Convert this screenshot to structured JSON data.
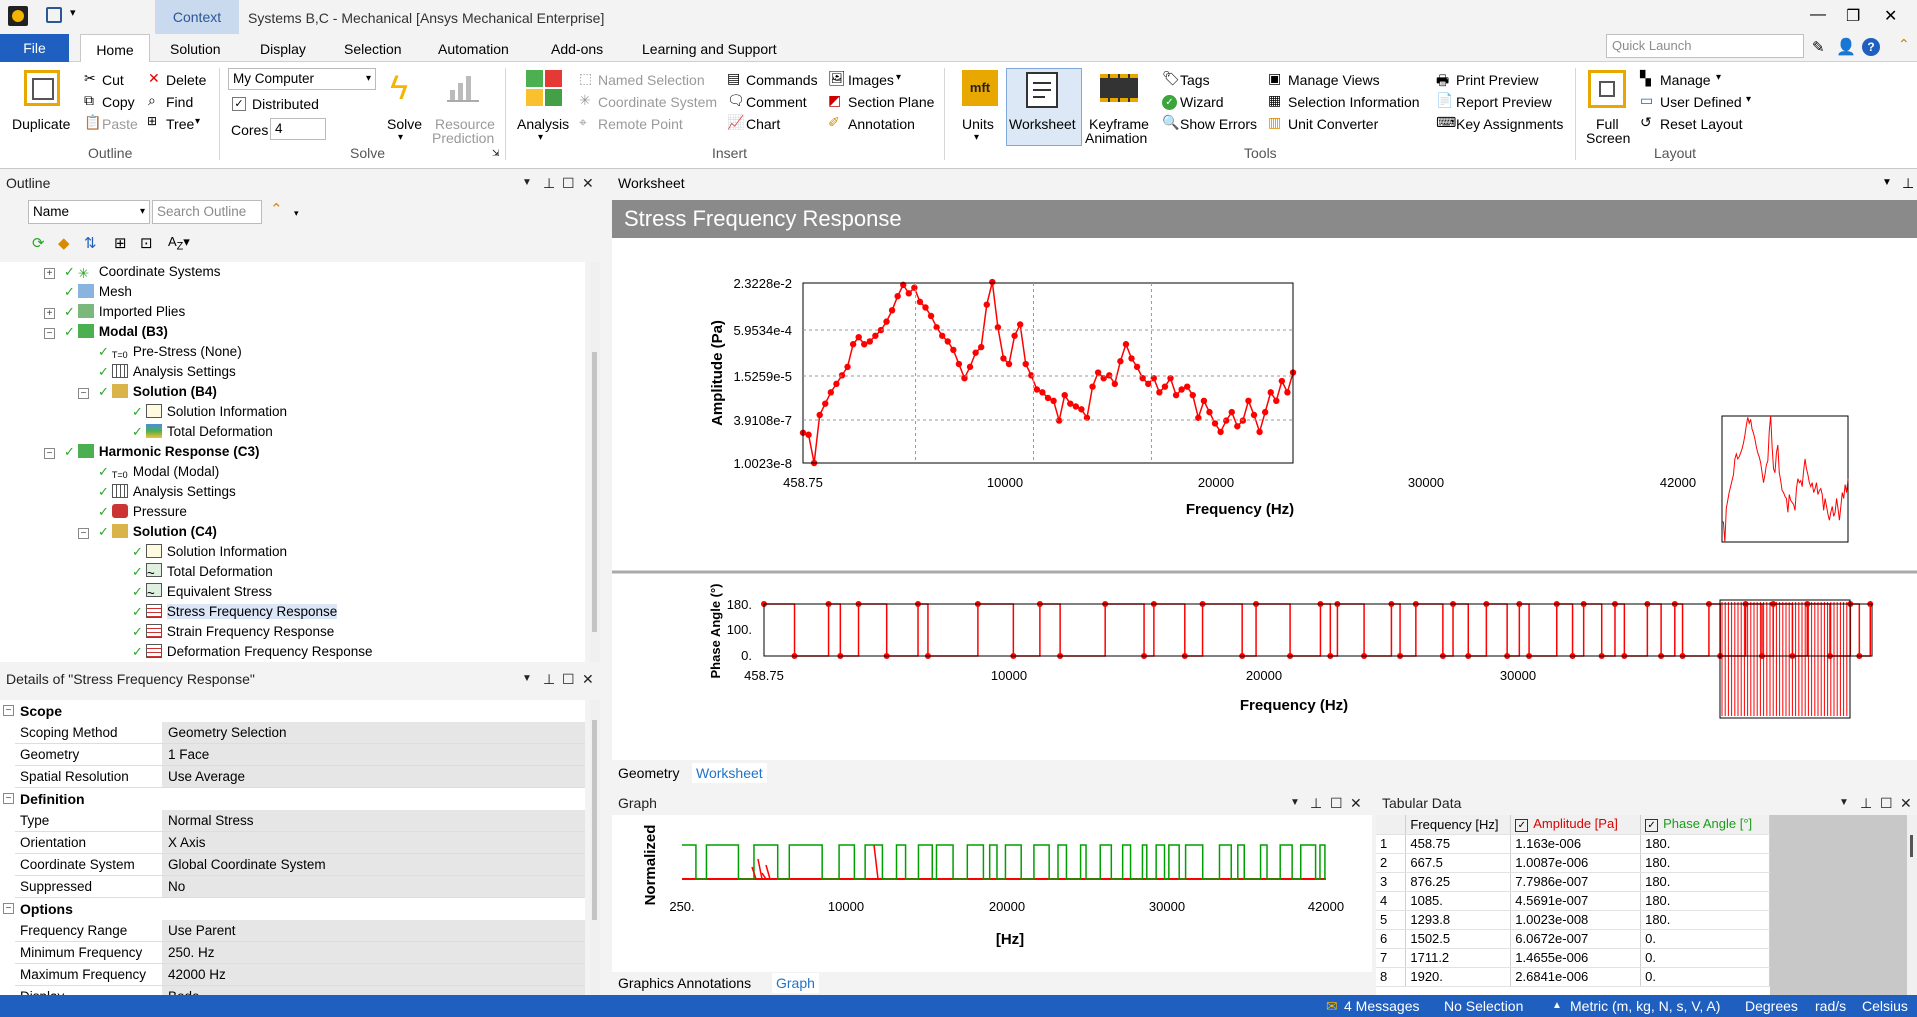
{
  "app": {
    "context_tab": "Context",
    "title": "Systems B,C - Mechanical [Ansys Mechanical Enterprise]",
    "quick_launch_placeholder": "Quick Launch"
  },
  "menu": {
    "file": "File",
    "tabs": [
      "Home",
      "Solution",
      "Display",
      "Selection",
      "Automation",
      "Add-ons",
      "Learning and Support"
    ]
  },
  "ribbon": {
    "outline": {
      "duplicate": "Duplicate",
      "cut": "Cut",
      "copy": "Copy",
      "paste": "Paste",
      "delete": "Delete",
      "find": "Find",
      "tree": "Tree",
      "group": "Outline"
    },
    "solve": {
      "computer": "My Computer",
      "distributed": "Distributed",
      "cores_label": "Cores",
      "cores_value": "4",
      "solve": "Solve",
      "resource1": "Resource",
      "resource2": "Prediction",
      "group": "Solve"
    },
    "insert": {
      "analysis": "Analysis",
      "named_selection": "Named Selection",
      "coordinate_system": "Coordinate System",
      "remote_point": "Remote Point",
      "commands": "Commands",
      "comment": "Comment",
      "chart": "Chart",
      "images": "Images",
      "section_plane": "Section Plane",
      "annotation": "Annotation",
      "group": "Insert"
    },
    "tools": {
      "units": "Units",
      "worksheet": "Worksheet",
      "keyframe1": "Keyframe",
      "keyframe2": "Animation",
      "tags": "Tags",
      "wizard": "Wizard",
      "show_errors": "Show Errors",
      "manage_views": "Manage Views",
      "selection_information": "Selection Information",
      "unit_converter": "Unit Converter",
      "print_preview": "Print Preview",
      "report_preview": "Report Preview",
      "key_assignments": "Key Assignments",
      "group": "Tools"
    },
    "layout": {
      "full1": "Full",
      "full2": "Screen",
      "manage": "Manage",
      "user_defined": "User Defined",
      "reset_layout": "Reset Layout",
      "group": "Layout"
    }
  },
  "outline": {
    "title": "Outline",
    "filter": "Name",
    "search_placeholder": "Search Outline",
    "items": [
      {
        "label": "Coordinate Systems"
      },
      {
        "label": "Mesh"
      },
      {
        "label": "Imported Plies"
      },
      {
        "label": "Modal (B3)"
      },
      {
        "label": "Pre-Stress (None)"
      },
      {
        "label": "Analysis Settings"
      },
      {
        "label": "Solution (B4)"
      },
      {
        "label": "Solution Information"
      },
      {
        "label": "Total Deformation"
      },
      {
        "label": "Harmonic Response (C3)"
      },
      {
        "label": "Modal (Modal)"
      },
      {
        "label": "Analysis Settings"
      },
      {
        "label": "Pressure"
      },
      {
        "label": "Solution (C4)"
      },
      {
        "label": "Solution Information"
      },
      {
        "label": "Total Deformation"
      },
      {
        "label": "Equivalent Stress"
      },
      {
        "label": "Stress Frequency Response"
      },
      {
        "label": "Strain Frequency Response"
      },
      {
        "label": "Deformation Frequency Response"
      }
    ]
  },
  "details": {
    "title": "Details of \"Stress Frequency Response\"",
    "sections": [
      "Scope",
      "Definition",
      "Options"
    ],
    "rows": [
      {
        "k": "Scoping Method",
        "v": "Geometry Selection"
      },
      {
        "k": "Geometry",
        "v": "1 Face"
      },
      {
        "k": "Spatial Resolution",
        "v": "Use Average"
      },
      {
        "k": "Type",
        "v": "Normal Stress"
      },
      {
        "k": "Orientation",
        "v": "X Axis"
      },
      {
        "k": "Coordinate System",
        "v": "Global Coordinate System"
      },
      {
        "k": "Suppressed",
        "v": "No"
      },
      {
        "k": "Frequency Range",
        "v": "Use Parent"
      },
      {
        "k": "Minimum Frequency",
        "v": "250. Hz"
      },
      {
        "k": "Maximum Frequency",
        "v": "42000 Hz"
      },
      {
        "k": "Display",
        "v": "Bode"
      }
    ]
  },
  "worksheet": {
    "title": "Worksheet",
    "banner": "Stress Frequency Response",
    "tabs": [
      "Geometry",
      "Worksheet"
    ]
  },
  "graph_panel": {
    "title": "Graph",
    "tabs": [
      "Graphics Annotations",
      "Graph"
    ]
  },
  "tabular": {
    "title": "Tabular Data",
    "headers": [
      "Frequency [Hz]",
      "Amplitude [Pa]",
      "Phase Angle [°]"
    ],
    "rows": [
      [
        "1",
        "458.75",
        "1.163e-006",
        "180."
      ],
      [
        "2",
        "667.5",
        "1.0087e-006",
        "180."
      ],
      [
        "3",
        "876.25",
        "7.7986e-007",
        "180."
      ],
      [
        "4",
        "1085.",
        "4.5691e-007",
        "180."
      ],
      [
        "5",
        "1293.8",
        "1.0023e-008",
        "180."
      ],
      [
        "6",
        "1502.5",
        "6.0672e-007",
        "0."
      ],
      [
        "7",
        "1711.2",
        "1.4655e-006",
        "0."
      ],
      [
        "8",
        "1920.",
        "2.6841e-006",
        "0."
      ]
    ]
  },
  "status": {
    "messages": "4 Messages",
    "selection": "No Selection",
    "units": "Metric (m, kg, N, s, V, A)",
    "angle": "Degrees",
    "rate": "rad/s",
    "temp": "Celsius"
  },
  "colors": {
    "accent": "#1f5fbf",
    "series_amp": "#ff0000",
    "series_phase": "#00a000"
  },
  "chart_data": [
    {
      "type": "line",
      "title": "",
      "xlabel": "Frequency (Hz)",
      "ylabel": "Amplitude (Pa)",
      "xlim": [
        458.75,
        42000
      ],
      "ylim_log": [
        1.0023e-08,
        0.023228
      ],
      "x_ticks": [
        "458.75",
        "10000",
        "20000",
        "30000",
        "42000"
      ],
      "y_ticks": [
        "2.3228e-2",
        "5.9534e-4",
        "1.5259e-5",
        "3.9108e-7",
        "1.0023e-8"
      ],
      "series": [
        {
          "values_log10": [
            -6.93,
            -7.0,
            -8.0,
            -6.3,
            -5.9,
            -5.5,
            -5.2,
            -4.9,
            -4.6,
            -3.8,
            -3.55,
            -3.8,
            -3.7,
            -3.5,
            -3.3,
            -3.0,
            -2.6,
            -2.1,
            -1.7,
            -2.0,
            -1.8,
            -2.3,
            -2.5,
            -2.8,
            -3.2,
            -3.5,
            -3.7,
            -4.0,
            -4.5,
            -5.0,
            -4.6,
            -4.1,
            -3.9,
            -2.4,
            -1.6,
            -3.2,
            -4.3,
            -4.5,
            -3.5,
            -3.1,
            -4.5,
            -4.9,
            -5.4,
            -5.5,
            -5.7,
            -5.8,
            -6.5,
            -5.6,
            -5.9,
            -6.0,
            -6.1,
            -6.4,
            -5.3,
            -4.8,
            -5.0,
            -4.9,
            -5.2,
            -4.4,
            -3.8,
            -4.3,
            -4.6,
            -5.0,
            -5.2,
            -5.0,
            -5.5,
            -5.3,
            -5.0,
            -5.6,
            -5.4,
            -5.3,
            -5.6,
            -6.4,
            -5.8,
            -6.2,
            -6.6,
            -6.9,
            -6.5,
            -6.2,
            -6.7,
            -6.5,
            -5.8,
            -6.3,
            -6.9,
            -6.2,
            -5.5,
            -5.8,
            -5.1,
            -5.5,
            -4.8
          ]
        }
      ]
    },
    {
      "type": "line",
      "title": "",
      "xlabel": "Frequency (Hz)",
      "ylabel": "Phase Angle (°)",
      "xlim": [
        458.75,
        42000
      ],
      "ylim": [
        0,
        180
      ],
      "x_ticks": [
        "458.75",
        "10000",
        "20000",
        "30000"
      ],
      "y_ticks": [
        "180.",
        "100.",
        "0."
      ],
      "series": [
        {
          "pattern": "alternating 0/180"
        }
      ]
    },
    {
      "type": "line",
      "title": "",
      "xlabel": "[Hz]",
      "ylabel": "Normalized",
      "xlim": [
        250,
        42000
      ],
      "x_ticks": [
        "250.",
        "10000",
        "20000",
        "30000",
        "42000"
      ],
      "series": [
        {
          "name": "Amplitude [Pa]"
        },
        {
          "name": "Phase Angle [°]"
        }
      ]
    }
  ]
}
